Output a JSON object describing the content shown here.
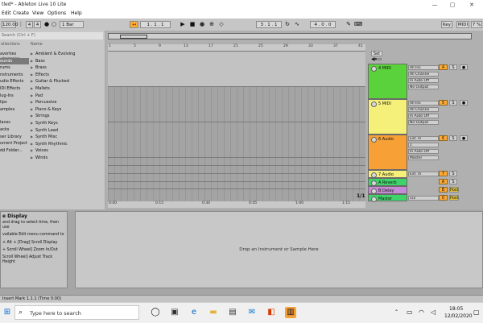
{
  "window": {
    "title": "tled* - Ableton Live 10 Lite",
    "min_glyph": "—",
    "restore_glyph": "▢",
    "close_glyph": "✕"
  },
  "menu": [
    "Edit",
    "Create",
    "View",
    "Options",
    "Help"
  ],
  "transport": {
    "tempo": "120.00",
    "time_sig_num": "4",
    "time_sig_den": "4",
    "quantize": "1 Bar",
    "position": "1 . 1 . 1",
    "loop_start": "3 . 1 . 1",
    "loop_len": "4 . 0 . 0",
    "key_label": "Key",
    "midi_label": "MIDI",
    "cpu": "7 %"
  },
  "browser": {
    "search_placeholder": "Search (Ctrl + F)",
    "col_categories": "ollections",
    "col_places": "ategories",
    "col_name": "Name",
    "categories": [
      "avorites",
      "ounds",
      "rums",
      "nstruments",
      "udio Effects",
      "IDI Effects",
      "lug-Ins",
      "lips",
      "amples",
      "laces",
      "acks",
      "ser Library",
      "urrent Project",
      "dd Folder..."
    ],
    "selected_category": 1,
    "items": [
      "Ambient & Evolving",
      "Bass",
      "Brass",
      "Effects",
      "Guitar & Plucked",
      "Mallets",
      "Pad",
      "Percussive",
      "Piano & Keys",
      "Strings",
      "Synth Keys",
      "Synth Lead",
      "Synth Misc",
      "Synth Rhythmic",
      "Voices",
      "Winds"
    ]
  },
  "arrangement": {
    "ruler_ticks": [
      "1",
      "5",
      "9",
      "13",
      "17",
      "21",
      "25",
      "29",
      "33",
      "37",
      "41"
    ],
    "time_ticks": [
      "0:00",
      "0:15",
      "0:30",
      "0:45",
      "1:00",
      "1:15"
    ],
    "set_label": "Set",
    "fraction": "1/1"
  },
  "tracks": [
    {
      "name": "4 MIDI",
      "color": "#5ad23c",
      "input": "All Ins",
      "channel": "All Channe",
      "monitor": "In Auto Off",
      "output": "No Output",
      "number": "4",
      "s": "S"
    },
    {
      "name": "5 MIDI",
      "color": "#f5f07a",
      "input": "All Ins",
      "channel": "All Channe",
      "monitor": "In Auto Off",
      "output": "No Output",
      "number": "5",
      "s": "S"
    },
    {
      "name": "6 Audio",
      "color": "#f7a035",
      "input": "Ext. In",
      "channel": "1",
      "monitor": "In Auto Off",
      "output": "Master",
      "number": "6",
      "s": "S"
    },
    {
      "name": "7 Audio",
      "color": "#f5f07a",
      "input": "Ext. In",
      "number": "7",
      "s": "S"
    },
    {
      "name": "A Reverb",
      "color": "#3fd46a",
      "number": "A",
      "s": "S"
    },
    {
      "name": "B Delay",
      "color": "#c78ad6",
      "number": "B",
      "s": "Post"
    },
    {
      "name": "Master",
      "color": "#3fd46a",
      "io": "1/2",
      "number": "0",
      "s": "Post"
    }
  ],
  "detail": {
    "heading": "e Display",
    "text1": "and drag to select time, then use",
    "text2": "vailable Edit menu command to",
    "text3": "+ Alt + [Drag] Scroll Display",
    "text4": "+ Scroll Wheel] Zoom In/Out",
    "text5": "Scroll Wheel] Adjust Track Height",
    "drop_text": "Drop an Instrument or Sample Here"
  },
  "status": {
    "text": "Insert Mark 1.1.1 (Time 0:00)"
  },
  "taskbar": {
    "search_placeholder": "Type here to search",
    "time": "18:05",
    "date": "12/02/2020"
  }
}
